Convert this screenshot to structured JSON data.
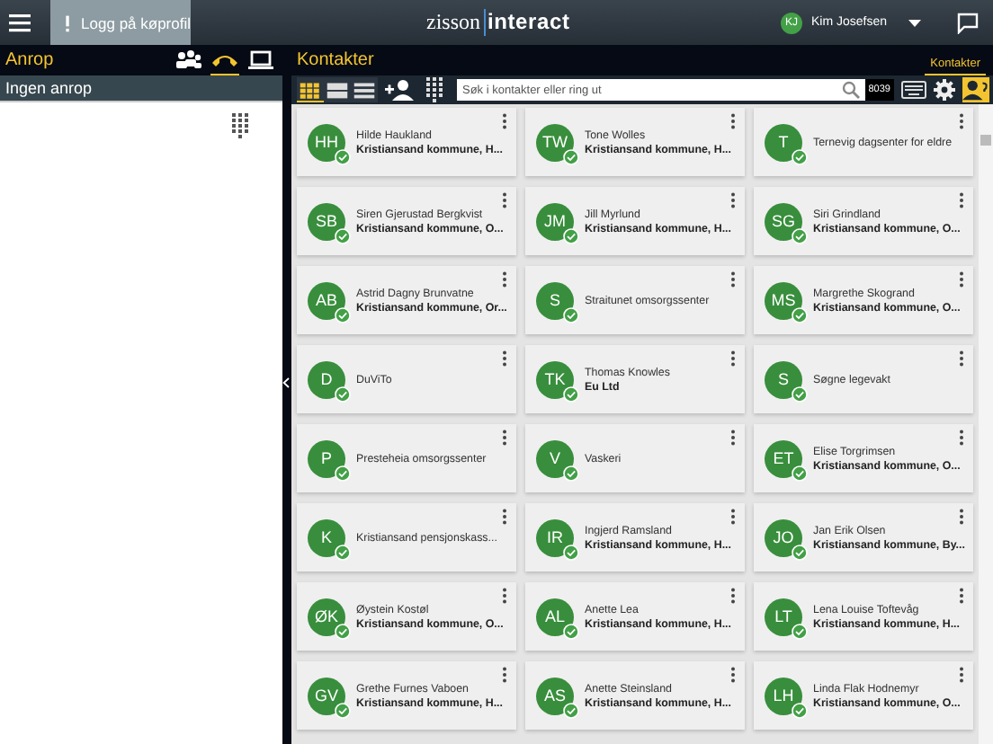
{
  "topbar": {
    "login_button": "Logg på køprofil",
    "logo_left": "zisson",
    "logo_right": "interact",
    "user": {
      "initials": "KJ",
      "name": "Kim Josefsen"
    }
  },
  "calls_panel": {
    "title": "Anrop",
    "tabs": [
      {
        "kind": "group",
        "selected": false
      },
      {
        "kind": "phone",
        "selected": true
      },
      {
        "kind": "screen",
        "selected": false
      }
    ],
    "status": "Ingen anrop"
  },
  "contacts_panel": {
    "title": "Kontakter",
    "tabs": [
      {
        "label": "Kontakter",
        "selected": true
      }
    ],
    "views": [
      {
        "kind": "grid",
        "selected": true
      },
      {
        "kind": "rows",
        "selected": false
      },
      {
        "kind": "list",
        "selected": false
      }
    ],
    "search": {
      "placeholder": "Søk i kontakter eller ring ut"
    },
    "extension": "8039",
    "contacts": [
      {
        "initials": "HH",
        "name": "Hilde Haukland",
        "org": "Kristiansand kommune, H..."
      },
      {
        "initials": "TW",
        "name": "Tone Wolles",
        "org": "Kristiansand kommune, H..."
      },
      {
        "initials": "T",
        "name": "Ternevig dagsenter for eldre"
      },
      {
        "initials": "SB",
        "name": "Siren Gjerustad Bergkvist",
        "org": "Kristiansand kommune, O..."
      },
      {
        "initials": "JM",
        "name": "Jill Myrlund",
        "org": "Kristiansand kommune, H..."
      },
      {
        "initials": "SG",
        "name": "Siri Grindland",
        "org": "Kristiansand kommune, O..."
      },
      {
        "initials": "AB",
        "name": "Astrid Dagny Brunvatne",
        "org": "Kristiansand kommune, Or..."
      },
      {
        "initials": "S",
        "name": "Straitunet omsorgssenter"
      },
      {
        "initials": "MS",
        "name": "Margrethe Skogrand",
        "org": "Kristiansand kommune, O..."
      },
      {
        "initials": "D",
        "name": "DuViTo"
      },
      {
        "initials": "TK",
        "name": "Thomas Knowles",
        "org": "Eu Ltd"
      },
      {
        "initials": "S",
        "name": "Søgne legevakt"
      },
      {
        "initials": "P",
        "name": "Presteheia omsorgssenter"
      },
      {
        "initials": "V",
        "name": "Vaskeri"
      },
      {
        "initials": "ET",
        "name": "Elise Torgrimsen",
        "org": "Kristiansand kommune, O..."
      },
      {
        "initials": "K",
        "name": "Kristiansand pensjonskass..."
      },
      {
        "initials": "IR",
        "name": "Ingjerd Ramsland",
        "org": "Kristiansand kommune, H..."
      },
      {
        "initials": "JO",
        "name": "Jan Erik Olsen",
        "org": "Kristiansand kommune, By..."
      },
      {
        "initials": "ØK",
        "name": "Øystein Kostøl",
        "org": "Kristiansand kommune, O..."
      },
      {
        "initials": "AL",
        "name": "Anette Lea",
        "org": "Kristiansand kommune, H..."
      },
      {
        "initials": "LT",
        "name": "Lena Louise Toftevåg",
        "org": "Kristiansand kommune, H..."
      },
      {
        "initials": "GV",
        "name": "Grethe Furnes Vaboen",
        "org": "Kristiansand kommune, H..."
      },
      {
        "initials": "AS",
        "name": "Anette Steinsland",
        "org": "Kristiansand kommune, H..."
      },
      {
        "initials": "LH",
        "name": "Linda Flak Hodnemyr",
        "org": "Kristiansand kommune, O..."
      }
    ]
  }
}
